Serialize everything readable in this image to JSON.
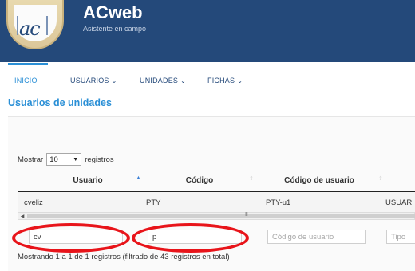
{
  "app": {
    "logo_text": "ac",
    "title": "ACweb",
    "subtitle": "Asistente en campo"
  },
  "nav": {
    "items": [
      {
        "label": "INICIO",
        "active": true,
        "has_dropdown": false
      },
      {
        "label": "USUARIOS",
        "active": false,
        "has_dropdown": true
      },
      {
        "label": "UNIDADES",
        "active": false,
        "has_dropdown": true
      },
      {
        "label": "FICHAS",
        "active": false,
        "has_dropdown": true
      }
    ],
    "dropdown_glyph": "⌄"
  },
  "page_title": "Usuarios de unidades",
  "length_menu": {
    "prefix": "Mostrar",
    "selected": "10",
    "suffix": "registros"
  },
  "table": {
    "columns": [
      "Usuario",
      "Código",
      "Código de usuario"
    ],
    "sort_icons": {
      "asc": "▲",
      "unsorted": "⇕"
    },
    "rows": [
      {
        "usuario": "cveliz",
        "codigo": "PTY",
        "codigo_usuario": "PTY-u1",
        "tipo": "USUARI"
      }
    ],
    "scrollbar_grip": "III",
    "scroll_left_glyph": "◀"
  },
  "filters": {
    "usuario_value": "cv",
    "codigo_value": "p",
    "codigo_usuario_placeholder": "Código de usuario",
    "tipo_placeholder": "Tipo"
  },
  "info_text": "Mostrando 1 a 1 de 1 registros (filtrado de 43 registros en total)",
  "colors": {
    "header_bg": "#24497a",
    "accent": "#2a8fd6",
    "highlight": "#e8141a"
  }
}
